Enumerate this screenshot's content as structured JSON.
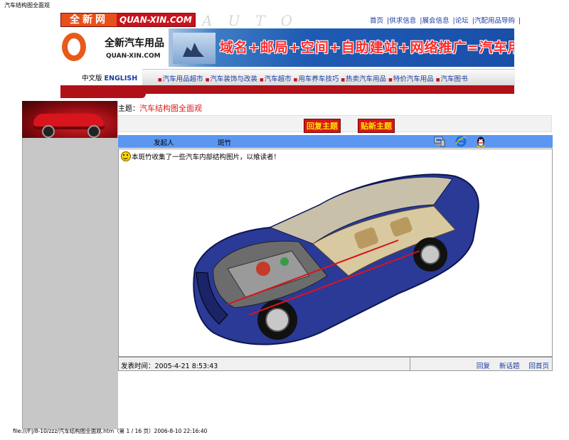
{
  "page_title": "汽车结构图全面观",
  "logo": {
    "tag_cn": "全新网",
    "tag_en": "QUAN-XIN.COM",
    "brand_cn": "全新汽车用品",
    "brand_en": "QUAN-XIN.COM",
    "watermark": "AUTO"
  },
  "top_nav": [
    "首页",
    "|供求信息",
    "|展会信息",
    "|论坛",
    "|汽配用品导购",
    "|"
  ],
  "banner_text": "域名+邮局+空间+自助建站+网络推广=汽车用品应有尽有",
  "language": {
    "cn": "中文版",
    "en": "ENGLISH"
  },
  "category_nav": [
    "汽车用品超市",
    "汽车装饰与改装",
    "汽车超市",
    "用车养车技巧",
    "热卖汽车用品",
    "特价汽车用品",
    "汽车图书"
  ],
  "topic": {
    "label": "主题：",
    "title": "汽车结构图全面观"
  },
  "buttons": {
    "reply": "回复主题",
    "new": "贴新主题"
  },
  "info_bar": {
    "poster_label": "发起人",
    "poster_name": "斑竹"
  },
  "post": {
    "text": "本斑竹收集了一些汽车内部结构图片，以飨读者！",
    "time_label": "发表时间：",
    "time_value": "2005-4-21 8:53:43"
  },
  "footer_links": [
    "回复",
    "新话题",
    "回首页"
  ],
  "bottom_status": "file:///F|/8-10/zzz/汽车结构图全面观.htm（第 1 / 16 页）2006-8-10 22:16:40",
  "colors": {
    "brand_red": "#c8141e",
    "info_bar_blue": "#5b97f0",
    "link_blue": "#1a3aa0",
    "left_column_gray": "#c7c7c7"
  },
  "icons": [
    "computer-icon",
    "ie-icon",
    "qq-icon",
    "smiley-icon"
  ]
}
